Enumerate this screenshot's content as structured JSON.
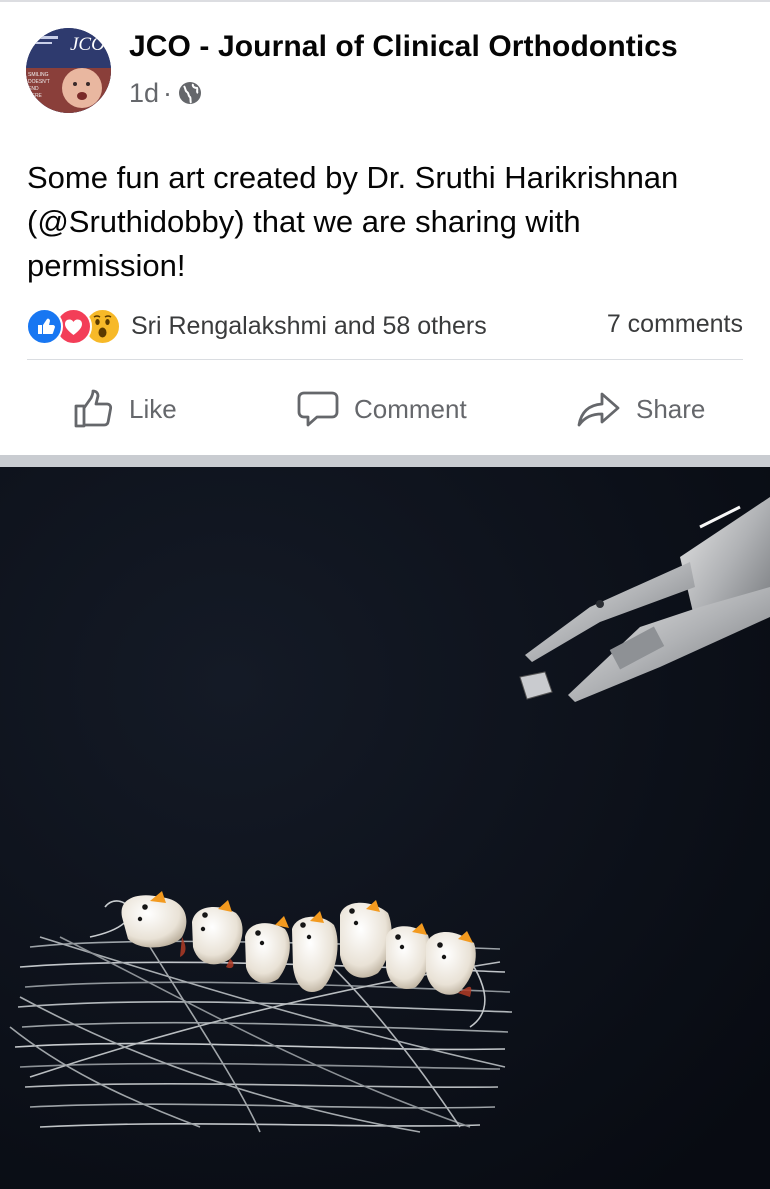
{
  "post": {
    "page_name": "JCO - Journal of Clinical Orthodontics",
    "time": "1d",
    "separator": "·",
    "avatar_logo_text": "JCO",
    "avatar_cover_lines": [
      "SMILING",
      "DOESN'T",
      "END",
      "HERE"
    ],
    "text_line1": "Some fun art created by Dr. Sruthi Harikrishnan",
    "text_line2": "(@Sruthidobby) that we are sharing with",
    "text_line3": "permission!"
  },
  "engagement": {
    "reactions": [
      "like-icon",
      "love-icon",
      "wow-icon"
    ],
    "reactors_text": "Sri Rengalakshmi and 58 others",
    "comments_text": "7 comments"
  },
  "actions": {
    "like_label": "Like",
    "comment_label": "Comment",
    "share_label": "Share"
  },
  "colors": {
    "like_blue": "#1877f2",
    "love_red": "#f33e58",
    "wow_yellow": "#f7b928",
    "secondary_text": "#65676b",
    "photo_background": "#0c1019"
  }
}
